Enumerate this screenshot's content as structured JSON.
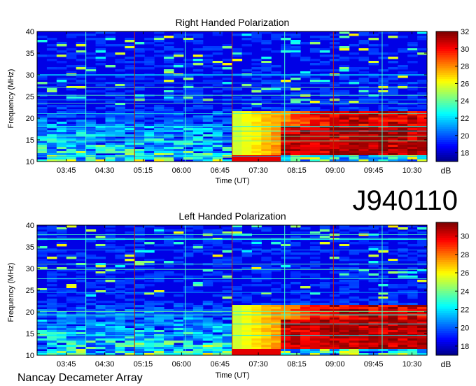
{
  "chart_data": [
    {
      "type": "heatmap",
      "title": "Right Handed Polarization",
      "xlabel": "Time (UT)",
      "ylabel": "Frequency (MHz)",
      "x_ticks": [
        "03:45",
        "04:30",
        "05:15",
        "06:00",
        "06:45",
        "07:30",
        "08:15",
        "09:00",
        "09:45",
        "10:30"
      ],
      "y_ticks": [
        10,
        15,
        20,
        25,
        30,
        35,
        40
      ],
      "ylim": [
        10,
        40
      ],
      "colorbar": {
        "label": "dB",
        "ticks": [
          18,
          20,
          22,
          24,
          26,
          28,
          30,
          32
        ],
        "range": [
          17,
          32
        ]
      }
    },
    {
      "type": "heatmap",
      "title": "Left Handed Polarization",
      "xlabel": "Time (UT)",
      "ylabel": "Frequency (MHz)",
      "x_ticks": [
        "03:45",
        "04:30",
        "05:15",
        "06:00",
        "06:45",
        "07:30",
        "08:15",
        "09:00",
        "09:45",
        "10:30"
      ],
      "y_ticks": [
        10,
        15,
        20,
        25,
        30,
        35,
        40
      ],
      "ylim": [
        10,
        40
      ],
      "colorbar": {
        "label": "dB",
        "ticks": [
          18,
          20,
          22,
          24,
          26,
          28,
          30
        ],
        "range": [
          17,
          31.5
        ]
      }
    }
  ],
  "observation_id": "J940110",
  "instrument": "Nancay Decameter Array"
}
